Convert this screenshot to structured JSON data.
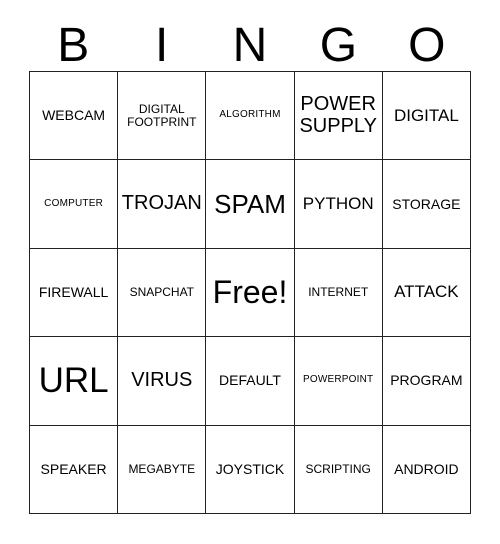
{
  "card": {
    "title": "BINGO",
    "header_letters": [
      "B",
      "I",
      "N",
      "G",
      "O"
    ],
    "free_space_label": "Free!",
    "colors": {
      "text": "#000000",
      "grid_line": "#222222",
      "background": "#ffffff"
    },
    "grid": {
      "rows": 5,
      "columns": 5
    },
    "rows": [
      [
        {
          "text": "WEBCAM",
          "size": "fs-md"
        },
        {
          "text": "DIGITAL\nFOOTPRINT",
          "size": "fs-sm"
        },
        {
          "text": "ALGORITHM",
          "size": "fs-xs"
        },
        {
          "text": "POWER\nSUPPLY",
          "size": "fs-xl"
        },
        {
          "text": "DIGITAL",
          "size": "fs-lg"
        }
      ],
      [
        {
          "text": "COMPUTER",
          "size": "fs-xs"
        },
        {
          "text": "TROJAN",
          "size": "fs-xl"
        },
        {
          "text": "SPAM",
          "size": "fs-xxl"
        },
        {
          "text": "PYTHON",
          "size": "fs-lg"
        },
        {
          "text": "STORAGE",
          "size": "fs-md"
        }
      ],
      [
        {
          "text": "FIREWALL",
          "size": "fs-md"
        },
        {
          "text": "SNAPCHAT",
          "size": "fs-sm"
        },
        {
          "text": "Free!",
          "size": "fs-huge"
        },
        {
          "text": "INTERNET",
          "size": "fs-sm"
        },
        {
          "text": "ATTACK",
          "size": "fs-lg"
        }
      ],
      [
        {
          "text": "URL",
          "size": "fs-max"
        },
        {
          "text": "VIRUS",
          "size": "fs-xl"
        },
        {
          "text": "DEFAULT",
          "size": "fs-md"
        },
        {
          "text": "POWERPOINT",
          "size": "fs-xs"
        },
        {
          "text": "PROGRAM",
          "size": "fs-md"
        }
      ],
      [
        {
          "text": "SPEAKER",
          "size": "fs-md"
        },
        {
          "text": "MEGABYTE",
          "size": "fs-sm"
        },
        {
          "text": "JOYSTICK",
          "size": "fs-md"
        },
        {
          "text": "SCRIPTING",
          "size": "fs-sm"
        },
        {
          "text": "ANDROID",
          "size": "fs-md"
        }
      ]
    ]
  }
}
